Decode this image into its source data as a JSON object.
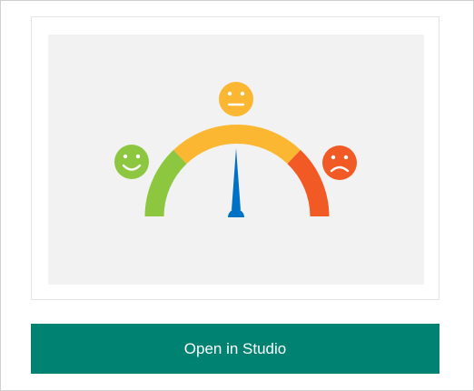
{
  "preview": {
    "icons": [
      "happy-face-icon",
      "neutral-face-icon",
      "sad-face-icon"
    ],
    "colors": {
      "good": "#8dc63f",
      "neutral": "#fbb731",
      "bad": "#f15a24",
      "needle": "#0072c6",
      "background": "#f2f2f2"
    }
  },
  "open_button": {
    "label": "Open in Studio",
    "color": "#008272"
  }
}
